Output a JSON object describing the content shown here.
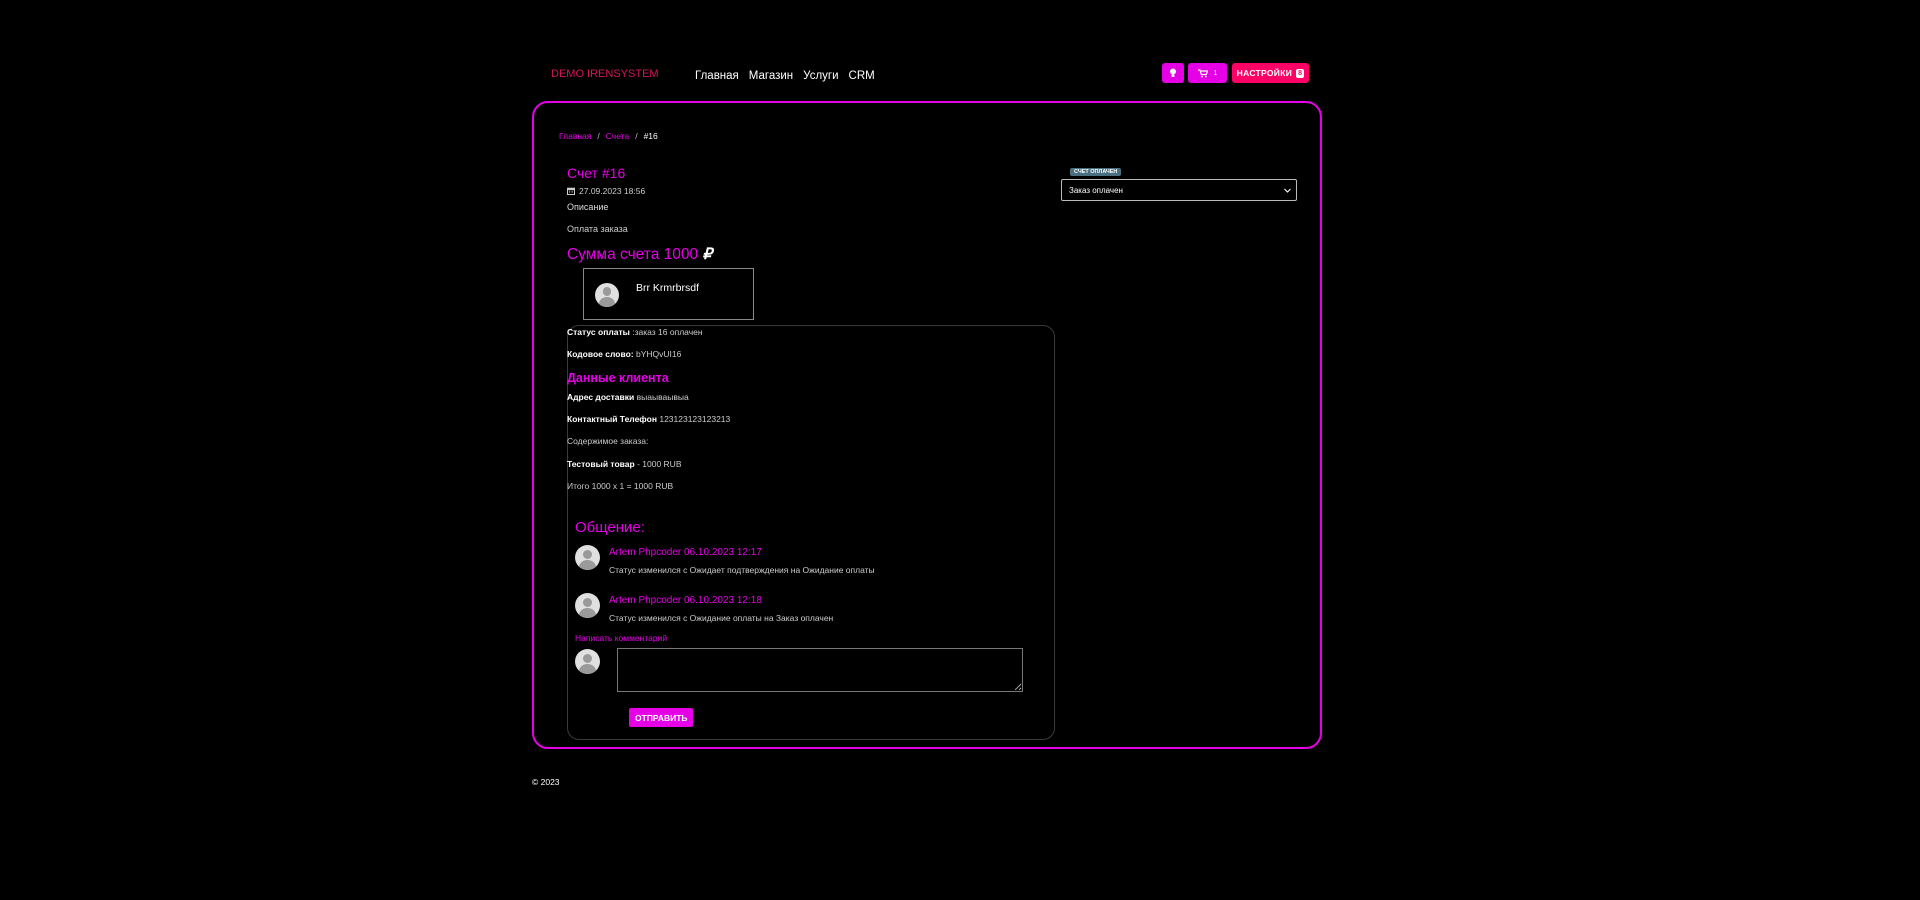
{
  "header": {
    "brand": "DEMO IRENSYSTEM",
    "nav": [
      "Главная",
      "Магазин",
      "Услуги",
      "CRM"
    ],
    "cart_count": "1",
    "settings_label": "НАСТРОЙКИ",
    "settings_badge": "8"
  },
  "breadcrumbs": {
    "home": "Главная",
    "section": "Счета",
    "current": "#16"
  },
  "invoice": {
    "title": "Счет #16",
    "date": "27.09.2023 18:56",
    "description_label": "Описание",
    "description": "Оплата заказа",
    "sum_label": "Сумма счета 1000",
    "currency": "₽"
  },
  "person": {
    "name": "Brr Krmrbrsdf"
  },
  "details": {
    "payment_status_label": "Статус оплаты",
    "payment_status_value": ":заказ 16 оплачен",
    "codeword_label": "Кодовое слово:",
    "codeword_value": "bYHQvUI16",
    "client_title": "Данные клиента",
    "address_label": "Адрес доставки",
    "address_value": "выаываывыа",
    "phone_label": "Контактный Телефон",
    "phone_value": "123123123123213",
    "contents_label": "Содержимое заказа:",
    "product_name": "Тестовый товар",
    "product_price": "- 1000 RUB",
    "total": "Итого 1000 х 1 = 1000 RUB"
  },
  "comments": {
    "title": "Общение:",
    "items": [
      {
        "author": "Artem Phpcoder 06.10.2023 12:17",
        "text": "Статус изменился с Ожидает подтверждения на Ожидание оплаты"
      },
      {
        "author": "Artem Phpcoder 06.10.2023 12:18",
        "text": "Статус изменился с Ожидание оплаты на Заказ оплачен"
      }
    ],
    "write_label": "Написать комментарий",
    "comment_value": "",
    "send_label": "ОТПРАВИТЬ"
  },
  "status": {
    "badge": "СЧЕТ ОПЛАЧЕН",
    "selected": "Заказ оплачен"
  },
  "footer": {
    "copyright": "© 2023"
  },
  "colors": {
    "accent": "#e600e6",
    "settings": "#ff0066",
    "brand": "#d4145a"
  },
  "icons": {
    "bulb": "lightbulb-icon",
    "cart": "cart-icon",
    "calendar": "calendar-icon",
    "chevron": "chevron-down-icon"
  }
}
